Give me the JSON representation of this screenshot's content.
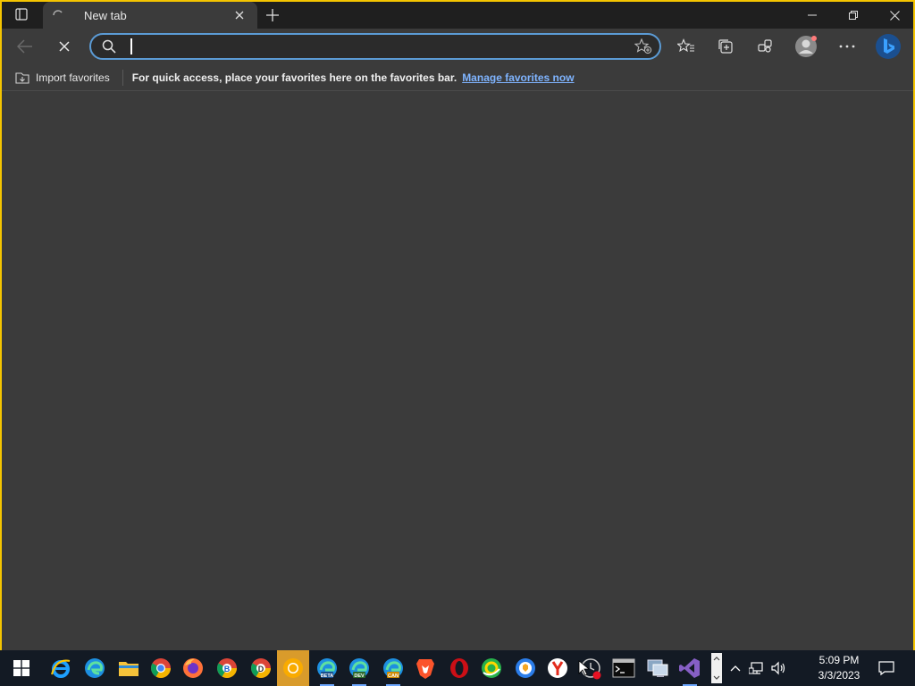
{
  "browser": {
    "tab_title": "New tab",
    "address_value": "",
    "address_placeholder": ""
  },
  "favorites_bar": {
    "import_label": "Import favorites",
    "message": "For quick access, place your favorites here on the favorites bar.",
    "manage_link": "Manage favorites now"
  },
  "taskbar": {
    "pinned": [
      "internet-explorer-icon",
      "edge-icon",
      "file-explorer-icon",
      "chrome-icon",
      "firefox-icon",
      "chrome-beta-icon",
      "chrome-dev-icon",
      "chrome-canary-icon",
      "edge-beta-icon",
      "edge-dev-icon",
      "edge-canary-icon",
      "brave-icon",
      "opera-icon",
      "360-browser-icon",
      "browser-shield-icon",
      "yandex-icon",
      "clock-app-icon",
      "command-prompt-icon",
      "remote-desktop-icon",
      "visual-studio-icon"
    ],
    "badges": {
      "edge_beta": "BETA",
      "edge_dev": "DEV",
      "edge_canary": "CAN",
      "chrome_beta": "B",
      "chrome_dev": "D"
    },
    "time": "5:09 PM",
    "date": "3/3/2023"
  },
  "colors": {
    "accent": "#5b9bd5",
    "link": "#7fb4ff",
    "content_bg": "#3b3b3b",
    "titlebar_bg": "#1f1f1f",
    "taskbar_bg": "#131a24",
    "active_taskbar": "#d99b2b"
  }
}
